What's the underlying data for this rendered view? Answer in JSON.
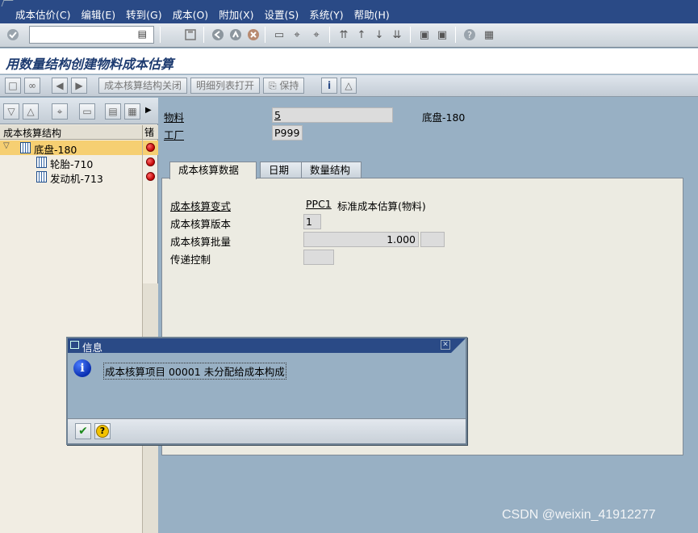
{
  "menubar": {
    "items": [
      "成本估价(C)",
      "编辑(E)",
      "转到(G)",
      "成本(O)",
      "附加(X)",
      "设置(S)",
      "系统(Y)",
      "帮助(H)"
    ]
  },
  "window": {
    "title": "用数量结构创建物料成本估算"
  },
  "app_toolbar": {
    "close_structure": "成本核算结构关闭",
    "open_itemization": "明细列表打开",
    "save": "保持"
  },
  "tree": {
    "col_structure": "成本核算结构",
    "col_status": "锗",
    "rows": [
      {
        "label": "底盘-180"
      },
      {
        "label": "轮胎-710"
      },
      {
        "label": "发动机-713"
      }
    ]
  },
  "header": {
    "material_label": "物料",
    "material_value": "5",
    "material_desc": "底盘-180",
    "plant_label": "工厂",
    "plant_value": "P999"
  },
  "tabs": [
    "成本核算数据",
    "日期",
    "数量结构"
  ],
  "costing": {
    "variant_label": "成本核算变式",
    "variant_value": "PPC1",
    "variant_desc": "标准成本估算(物料)",
    "version_label": "成本核算版本",
    "version_value": "1",
    "lot_label": "成本核算批量",
    "lot_value": "1.000",
    "transfer_label": "传递控制"
  },
  "dialog": {
    "title": "信息",
    "message": "成本核算项目 00001 未分配给成本构成"
  },
  "watermark": "CSDN @weixin_41912277",
  "colors": {
    "menubar_bg": "#2a4a86",
    "background": "#98b0c4",
    "selected_row": "#f6cf72",
    "status_red": "#c00000"
  }
}
